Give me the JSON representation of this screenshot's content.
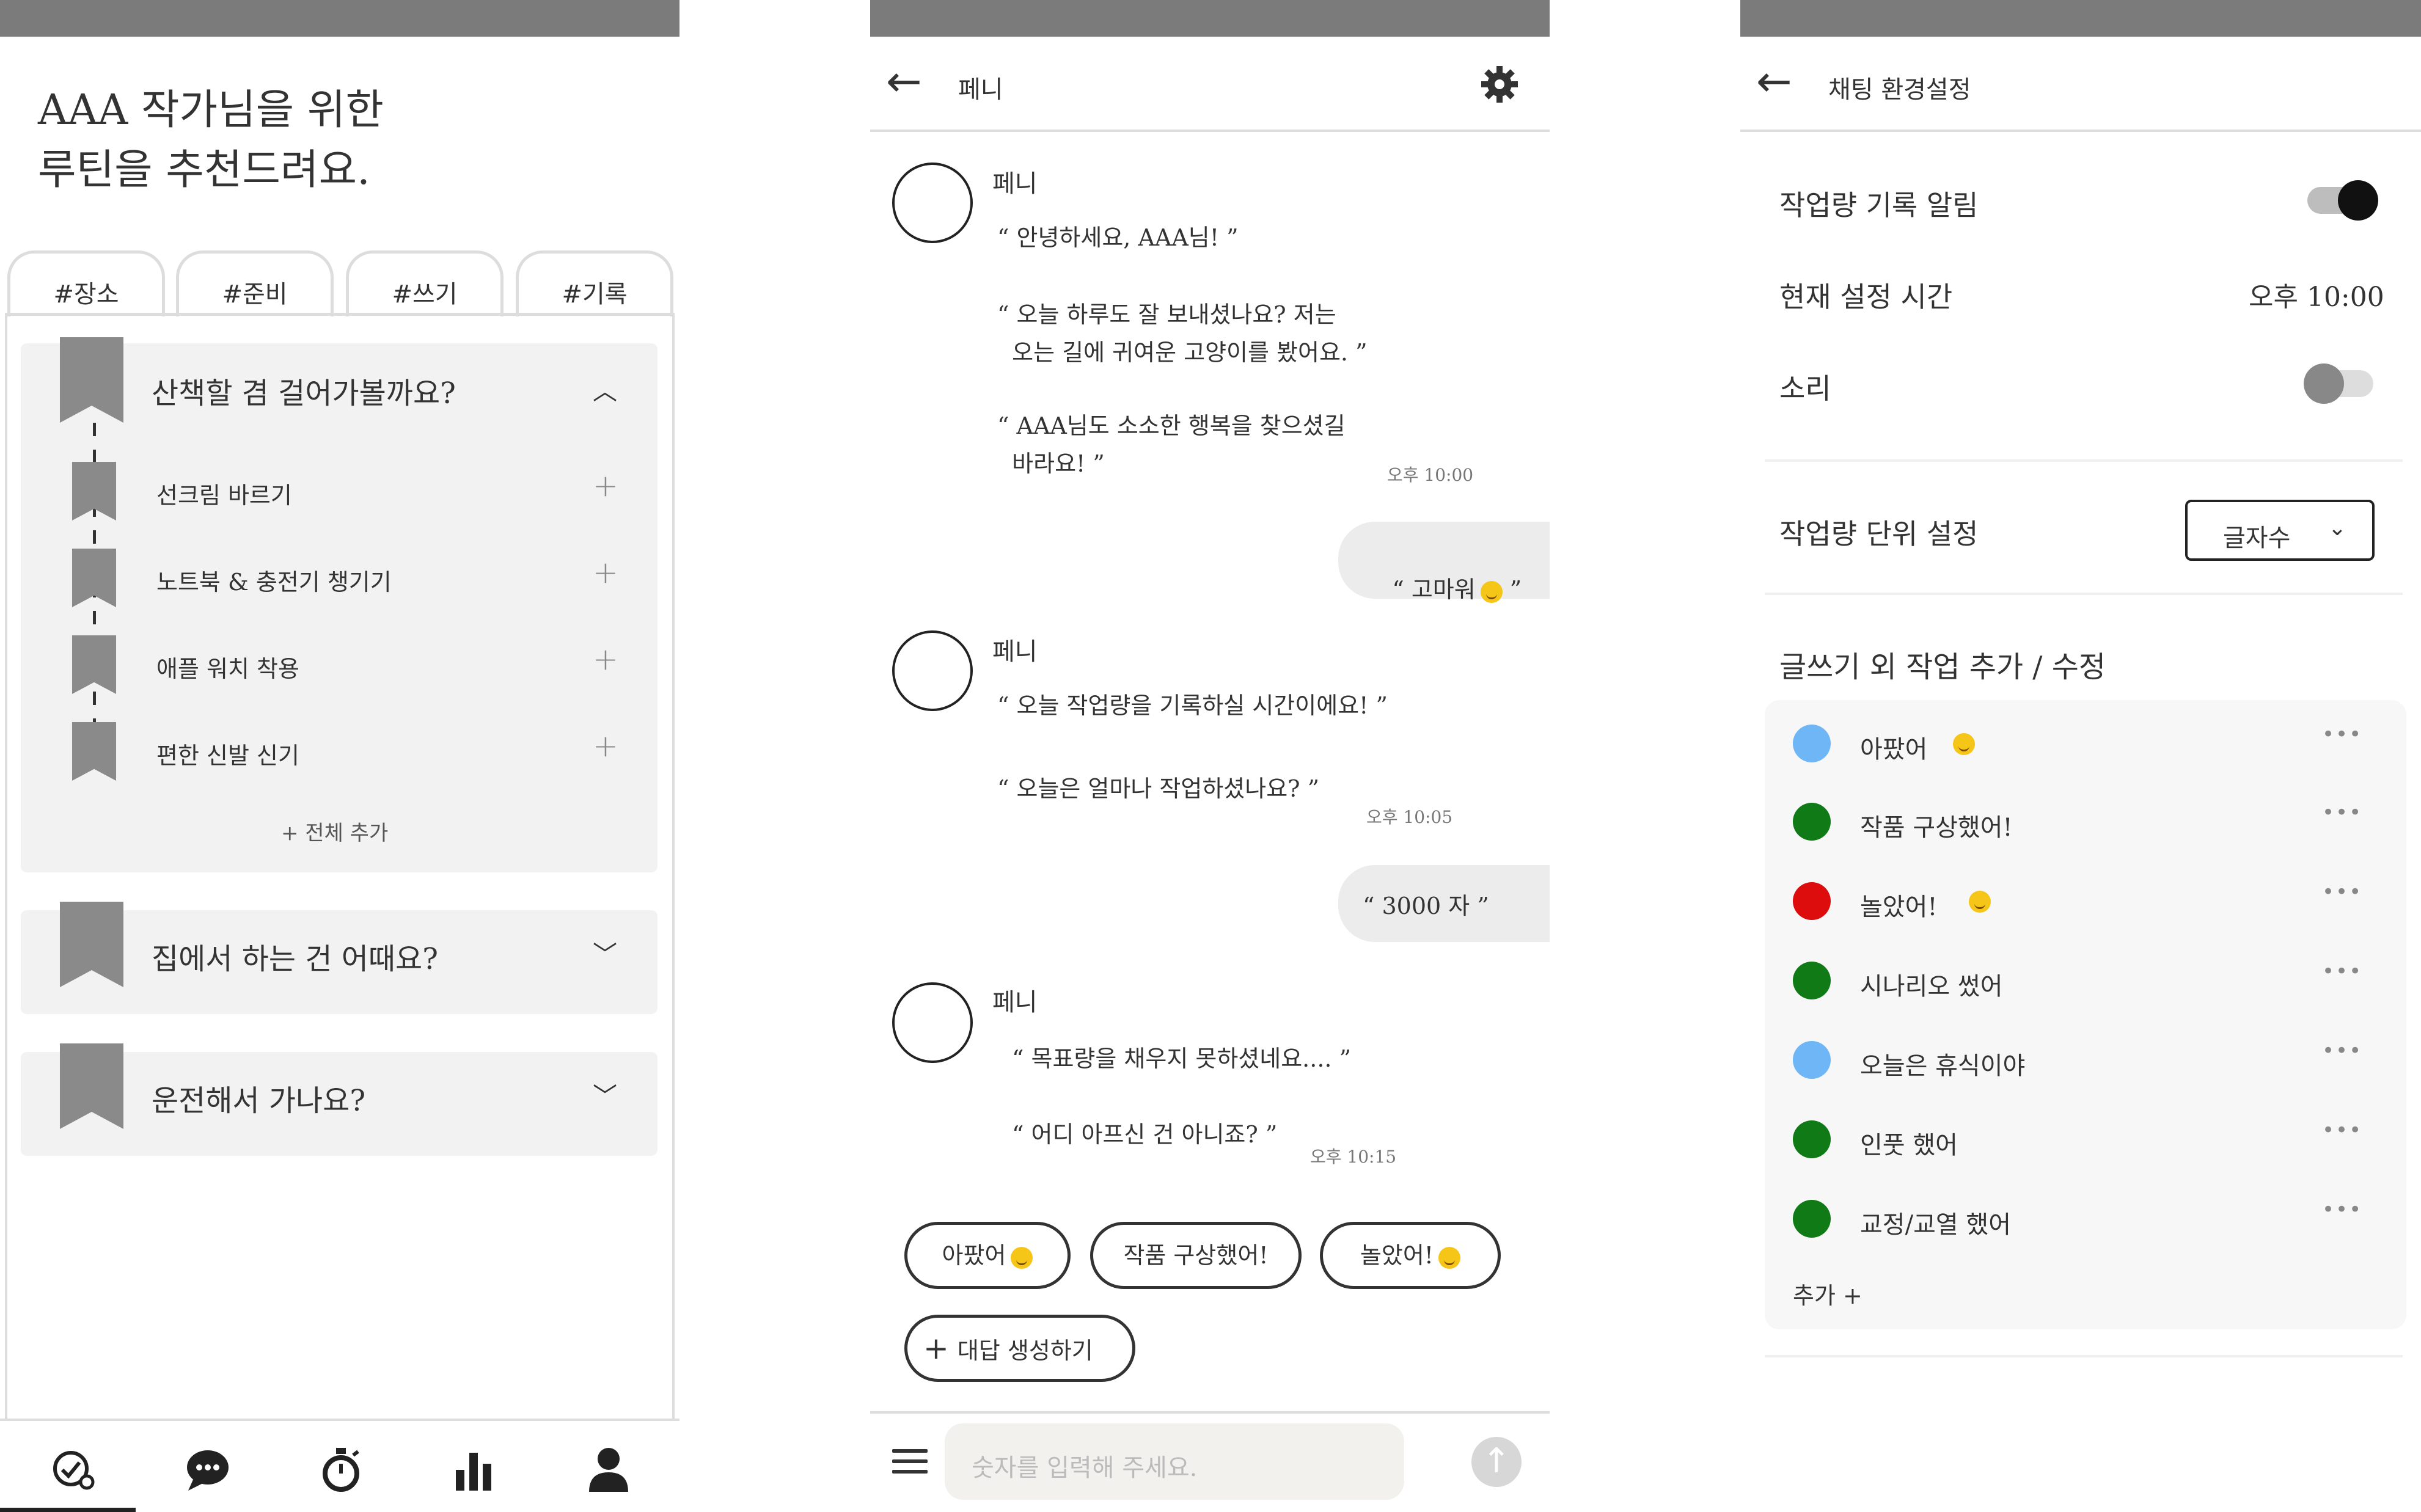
{
  "routine": {
    "title_line1": "AAA 작가님을 위한",
    "title_line2": "루틴을 추천드려요.",
    "tabs": [
      "#장소",
      "#준비",
      "#쓰기",
      "#기록"
    ],
    "sections": [
      {
        "title": "산책할 겸 걸어가볼까요?",
        "expanded": true,
        "items": [
          "선크림 바르기",
          "노트북 & 충전기 챙기기",
          "애플 워치 착용",
          "편한 신발 신기"
        ],
        "add_all": "+ 전체 추가"
      },
      {
        "title": "집에서 하는 건 어때요?",
        "expanded": false
      },
      {
        "title": "운전해서 가나요?",
        "expanded": false
      }
    ],
    "nav": [
      "home-icon",
      "chat-icon",
      "timer-icon",
      "stats-icon",
      "profile-icon"
    ]
  },
  "chat": {
    "header_title": "페니",
    "bot_name": "페니",
    "groups": [
      {
        "messages": [
          "“ 안녕하세요, AAA님! ”",
          "“ 오늘 하루도 잘 보내셨나요? 저는\n  오는 길에 귀여운 고양이를 봤어요. ”",
          "“ AAA님도 소소한 행복을 찾으셨길\n  바라요! ”"
        ],
        "time": "오후 10:00"
      },
      {
        "messages": [
          "“ 오늘 작업량을 기록하실 시간이에요! ”",
          "“ 오늘은 얼마나 작업하셨나요? ”"
        ],
        "time": "오후 10:05"
      },
      {
        "messages": [
          "“ 목표량을 채우지 못하셨네요.... ”",
          "“ 어디 아프신 건 아니죠? ”"
        ],
        "time": "오후 10:15"
      }
    ],
    "user_replies": [
      "“ 고마워",
      "“ 3000 자 ”"
    ],
    "quick_replies": [
      "아팠어",
      "작품 구상했어!",
      "놀았어!"
    ],
    "generate_label": "대답 생성하기",
    "input_placeholder": "숫자를 입력해 주세요."
  },
  "settings": {
    "header_title": "채팅 환경설정",
    "record_alarm_label": "작업량 기록 알림",
    "record_alarm_on": true,
    "time_label": "현재 설정 시간",
    "time_value": "오후 10:00",
    "sound_label": "소리",
    "sound_on": false,
    "unit_label": "작업량 단위 설정",
    "unit_value": "글자수",
    "tasks_title": "글쓰기 외 작업 추가 / 수정",
    "tasks": [
      {
        "label": "아팠어",
        "color": "#6fb6f6"
      },
      {
        "label": "작품 구상했어!",
        "color": "#0f7a16"
      },
      {
        "label": "놀았어!",
        "color": "#dd0d0d"
      },
      {
        "label": "시나리오 썼어",
        "color": "#0f7a16"
      },
      {
        "label": "오늘은 휴식이야",
        "color": "#6fb6f6"
      },
      {
        "label": "인풋 했어",
        "color": "#0f7a16"
      },
      {
        "label": "교정/교열 했어",
        "color": "#0f7a16"
      }
    ],
    "add_label": "추가 +"
  }
}
